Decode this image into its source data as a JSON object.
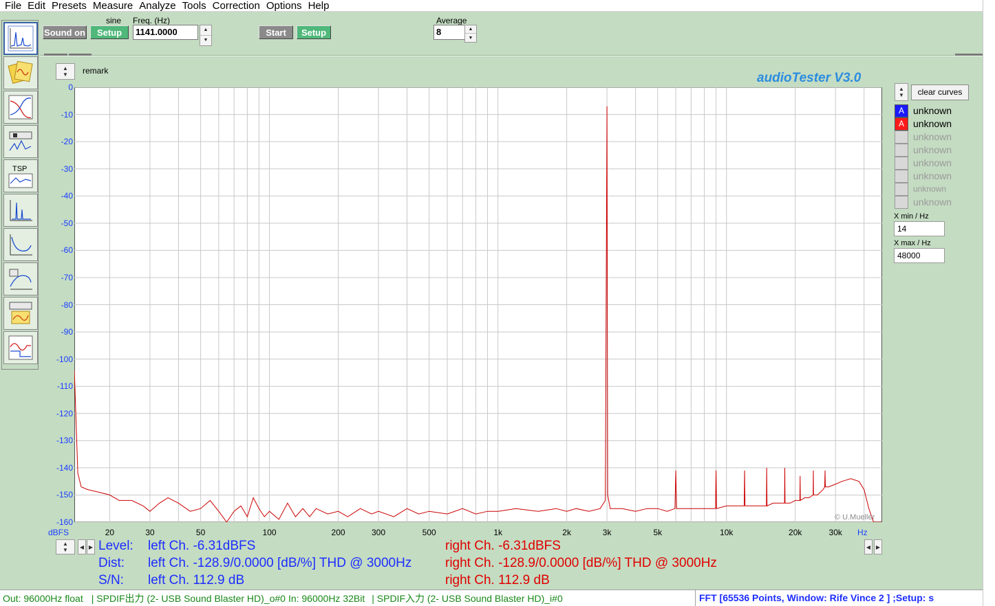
{
  "menu": [
    "File",
    "Edit",
    "Presets",
    "Measure",
    "Analyze",
    "Tools",
    "Correction",
    "Options",
    "Help"
  ],
  "toolbar": {
    "signal_label": "sine",
    "sound_button": "Sound on",
    "setup_button": "Setup",
    "freq_label": "Freq. (Hz)",
    "freq_value": "1141.0000",
    "start_button": "Start",
    "setup2_button": "Setup",
    "average_label": "Average",
    "average_value": "8"
  },
  "tools": [
    "spectrum-tool-icon",
    "generator-tool-icon",
    "frequency-response-tool-icon",
    "speaker-impedance-tool-icon",
    "tsp-tool-icon",
    "impulse-tool-icon",
    "distortion-sweep-tool-icon",
    "speaker-response-tool-icon",
    "crossover-tool-icon",
    "step-response-tool-icon"
  ],
  "tsp_label": "TSP",
  "remark": "remark",
  "app_title": "audioTester  V3.0",
  "copyright": "© U.Mueller",
  "clear_curves": "clear curves",
  "curves": [
    {
      "badge": "A",
      "label": "unknown",
      "active": true,
      "color": "#1a1aff"
    },
    {
      "badge": "A",
      "label": "unknown",
      "active": true,
      "color": "#ff1a1a"
    },
    {
      "badge": "",
      "label": "unknown",
      "active": false
    },
    {
      "badge": "",
      "label": "unknown",
      "active": false
    },
    {
      "badge": "",
      "label": "unknown",
      "active": false
    },
    {
      "badge": "",
      "label": "unknown",
      "active": false
    },
    {
      "badge": "",
      "label": "unknown",
      "active": false
    },
    {
      "badge": "",
      "label": "unknown",
      "active": false
    }
  ],
  "xmin_label": "X min / Hz",
  "xmin_value": "14",
  "xmax_label": "X max / Hz",
  "xmax_value": "48000",
  "readouts": {
    "level_label": "Level:",
    "level_left": "left Ch. -6.31dBFS",
    "level_right": "right Ch. -6.31dBFS",
    "dist_label": "Dist:",
    "dist_left": "left Ch. -128.9/0.0000 [dB/%] THD @ 3000Hz",
    "dist_right": "right Ch. -128.9/0.0000 [dB/%] THD @ 3000Hz",
    "sn_label": "S/N:",
    "sn_left": "left Ch. 112.9 dB",
    "sn_right": "right Ch. 112.9 dB"
  },
  "status": {
    "out": "Out: 96000Hz float",
    "out_dev": "SPDIF出力 (2- USB Sound Blaster HD)_o#0",
    "in": "In: 96000Hz 32Bit",
    "in_dev": "SPDIF入力 (2- USB Sound Blaster HD)_i#0",
    "fft": "FFT [65536 Points, Window: Rife Vince 2 ]  ;Setup: s"
  },
  "chart_data": {
    "type": "line",
    "title": "",
    "xlabel": "Hz",
    "ylabel": "dBFS",
    "x_scale": "log",
    "xlim": [
      14,
      48000
    ],
    "ylim": [
      -160,
      0
    ],
    "grid": true,
    "x_tick_labels": [
      {
        "v": 20,
        "t": "20"
      },
      {
        "v": 30,
        "t": "30"
      },
      {
        "v": 50,
        "t": "50"
      },
      {
        "v": 100,
        "t": "100"
      },
      {
        "v": 200,
        "t": "200"
      },
      {
        "v": 300,
        "t": "300"
      },
      {
        "v": 500,
        "t": "500"
      },
      {
        "v": 1000,
        "t": "1k"
      },
      {
        "v": 2000,
        "t": "2k"
      },
      {
        "v": 3000,
        "t": "3k"
      },
      {
        "v": 5000,
        "t": "5k"
      },
      {
        "v": 10000,
        "t": "10k"
      },
      {
        "v": 20000,
        "t": "20k"
      },
      {
        "v": 30000,
        "t": "30k"
      }
    ],
    "y_ticks": [
      0,
      -10,
      -20,
      -30,
      -40,
      -50,
      -60,
      -70,
      -80,
      -90,
      -100,
      -110,
      -120,
      -130,
      -140,
      -150,
      -160
    ],
    "series": [
      {
        "color": "#cc0000",
        "points": [
          [
            14,
            -104
          ],
          [
            14.5,
            -142
          ],
          [
            15,
            -147
          ],
          [
            16,
            -148
          ],
          [
            18,
            -149
          ],
          [
            20,
            -150
          ],
          [
            22,
            -152
          ],
          [
            25,
            -152
          ],
          [
            28,
            -154
          ],
          [
            30,
            -156
          ],
          [
            33,
            -153
          ],
          [
            36,
            -151
          ],
          [
            40,
            -153
          ],
          [
            45,
            -156
          ],
          [
            50,
            -155
          ],
          [
            55,
            -152
          ],
          [
            60,
            -156
          ],
          [
            65,
            -160
          ],
          [
            70,
            -156
          ],
          [
            75,
            -154
          ],
          [
            80,
            -158
          ],
          [
            85,
            -151
          ],
          [
            90,
            -155
          ],
          [
            95,
            -158
          ],
          [
            100,
            -156
          ],
          [
            110,
            -159
          ],
          [
            120,
            -153
          ],
          [
            130,
            -158
          ],
          [
            140,
            -155
          ],
          [
            150,
            -158
          ],
          [
            160,
            -155
          ],
          [
            180,
            -157
          ],
          [
            200,
            -156
          ],
          [
            220,
            -158
          ],
          [
            250,
            -155
          ],
          [
            280,
            -157
          ],
          [
            300,
            -156
          ],
          [
            350,
            -158
          ],
          [
            400,
            -155
          ],
          [
            450,
            -157
          ],
          [
            500,
            -156
          ],
          [
            600,
            -157
          ],
          [
            700,
            -155
          ],
          [
            800,
            -157
          ],
          [
            900,
            -156
          ],
          [
            1000,
            -156
          ],
          [
            1200,
            -155
          ],
          [
            1500,
            -156
          ],
          [
            1800,
            -155
          ],
          [
            2000,
            -156
          ],
          [
            2200,
            -155
          ],
          [
            2500,
            -156
          ],
          [
            2800,
            -155
          ],
          [
            2950,
            -152
          ],
          [
            3000,
            -7
          ],
          [
            3020,
            -150
          ],
          [
            3100,
            -155
          ],
          [
            3500,
            -155
          ],
          [
            4000,
            -156
          ],
          [
            4500,
            -155
          ],
          [
            5000,
            -155
          ],
          [
            5500,
            -156
          ],
          [
            5950,
            -155
          ],
          [
            6000,
            -141
          ],
          [
            6050,
            -155
          ],
          [
            7000,
            -155
          ],
          [
            8000,
            -155
          ],
          [
            8950,
            -155
          ],
          [
            9000,
            -141
          ],
          [
            9050,
            -155
          ],
          [
            10000,
            -154
          ],
          [
            11000,
            -154
          ],
          [
            11950,
            -154
          ],
          [
            12000,
            -141
          ],
          [
            12050,
            -154
          ],
          [
            13000,
            -154
          ],
          [
            14000,
            -154
          ],
          [
            14950,
            -154
          ],
          [
            15000,
            -140
          ],
          [
            15050,
            -154
          ],
          [
            16000,
            -153
          ],
          [
            17000,
            -153
          ],
          [
            17950,
            -153
          ],
          [
            18000,
            -140
          ],
          [
            18050,
            -153
          ],
          [
            19000,
            -153
          ],
          [
            20000,
            -152
          ],
          [
            20950,
            -152
          ],
          [
            21000,
            -143
          ],
          [
            21050,
            -152
          ],
          [
            22000,
            -151
          ],
          [
            23000,
            -151
          ],
          [
            23950,
            -150
          ],
          [
            24000,
            -141
          ],
          [
            24050,
            -150
          ],
          [
            25000,
            -150
          ],
          [
            26500,
            -148
          ],
          [
            26900,
            -147
          ],
          [
            27000,
            -141
          ],
          [
            27100,
            -147
          ],
          [
            28000,
            -147
          ],
          [
            30000,
            -146
          ],
          [
            32000,
            -145
          ],
          [
            35000,
            -144
          ],
          [
            38000,
            -145
          ],
          [
            40000,
            -148
          ],
          [
            42000,
            -155
          ],
          [
            44000,
            -160
          ],
          [
            48000,
            -160
          ]
        ]
      }
    ]
  }
}
